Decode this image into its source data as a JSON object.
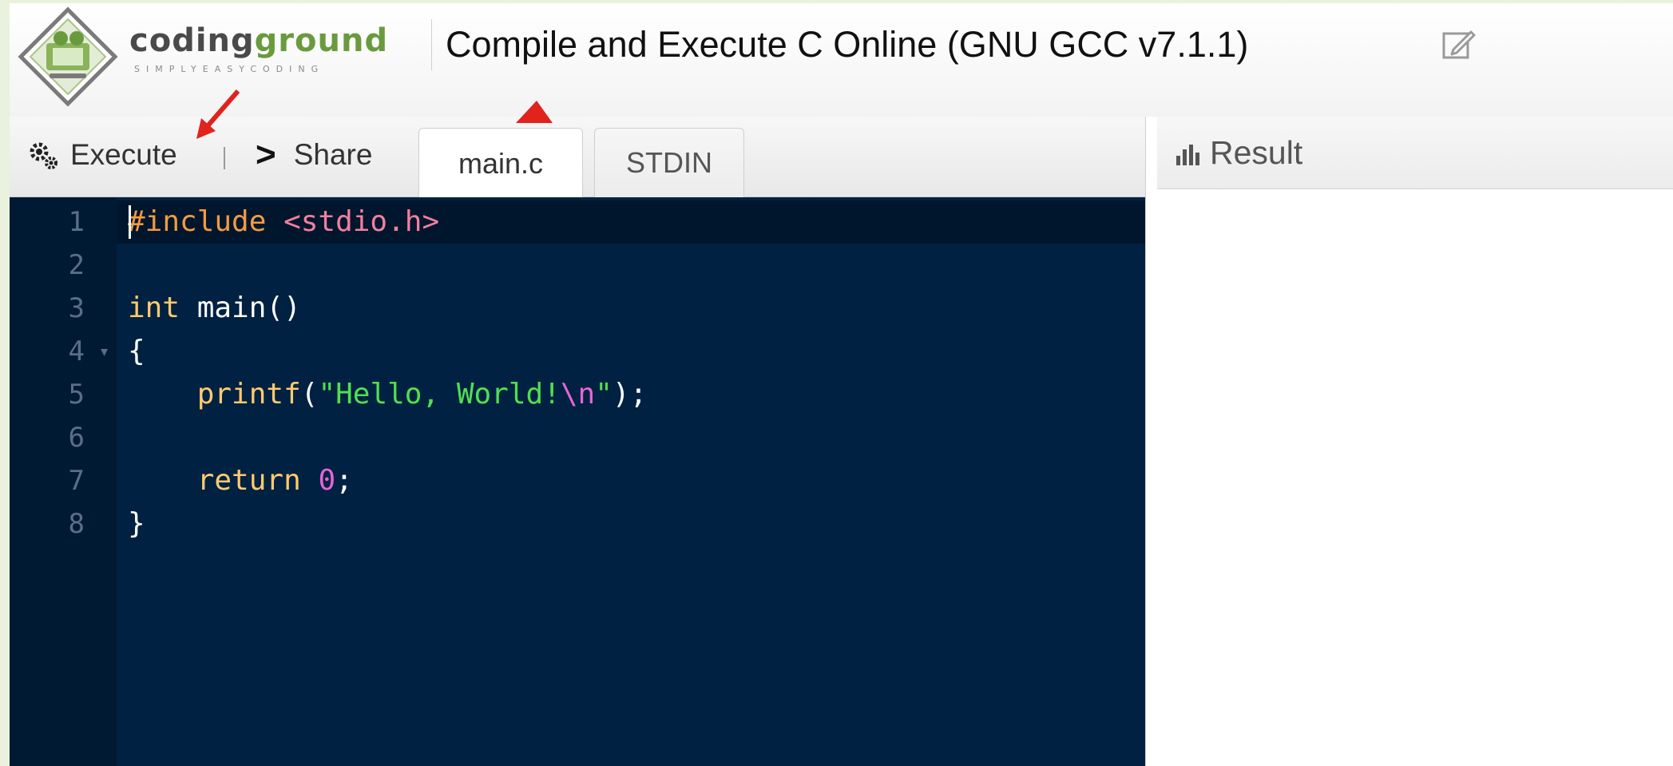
{
  "header": {
    "logo_name_part1": "coding",
    "logo_name_part2": "ground",
    "logo_tagline": "SIMPLYEASYCODING",
    "title": "Compile and Execute C Online (GNU GCC v7.1.1)"
  },
  "toolbar": {
    "execute_label": "Execute",
    "separator": "|",
    "share_label": "Share",
    "tabs": [
      {
        "label": "main.c",
        "active": true
      },
      {
        "label": "STDIN",
        "active": false
      }
    ]
  },
  "editor": {
    "lines": [
      {
        "number": "1",
        "text": "#include <stdio.h>"
      },
      {
        "number": "2",
        "text": ""
      },
      {
        "number": "3",
        "text": "int main()"
      },
      {
        "number": "4",
        "text": "{"
      },
      {
        "number": "5",
        "text": "    printf(\"Hello, World!\\n\");"
      },
      {
        "number": "6",
        "text": ""
      },
      {
        "number": "7",
        "text": "    return 0;"
      },
      {
        "number": "8",
        "text": "}"
      }
    ],
    "code_tokens": {
      "l1_directive": "#include",
      "l1_header": " <stdio.h>",
      "l3_type": "int",
      "l3_rest": " main()",
      "l4": "{",
      "l5_indent": "    ",
      "l5_fn": "printf",
      "l5_open": "(",
      "l5_str": "\"Hello, World!",
      "l5_esc": "\\n",
      "l5_strend": "\"",
      "l5_close": ");",
      "l7_indent": "    ",
      "l7_kw": "return",
      "l7_num": "0",
      "l7_semi": ";",
      "l8": "}"
    }
  },
  "result": {
    "title": "Result"
  },
  "colors": {
    "editor_bg": "#002141",
    "accent_green": "#6a9a3e",
    "annotation_red": "#e0231c"
  }
}
